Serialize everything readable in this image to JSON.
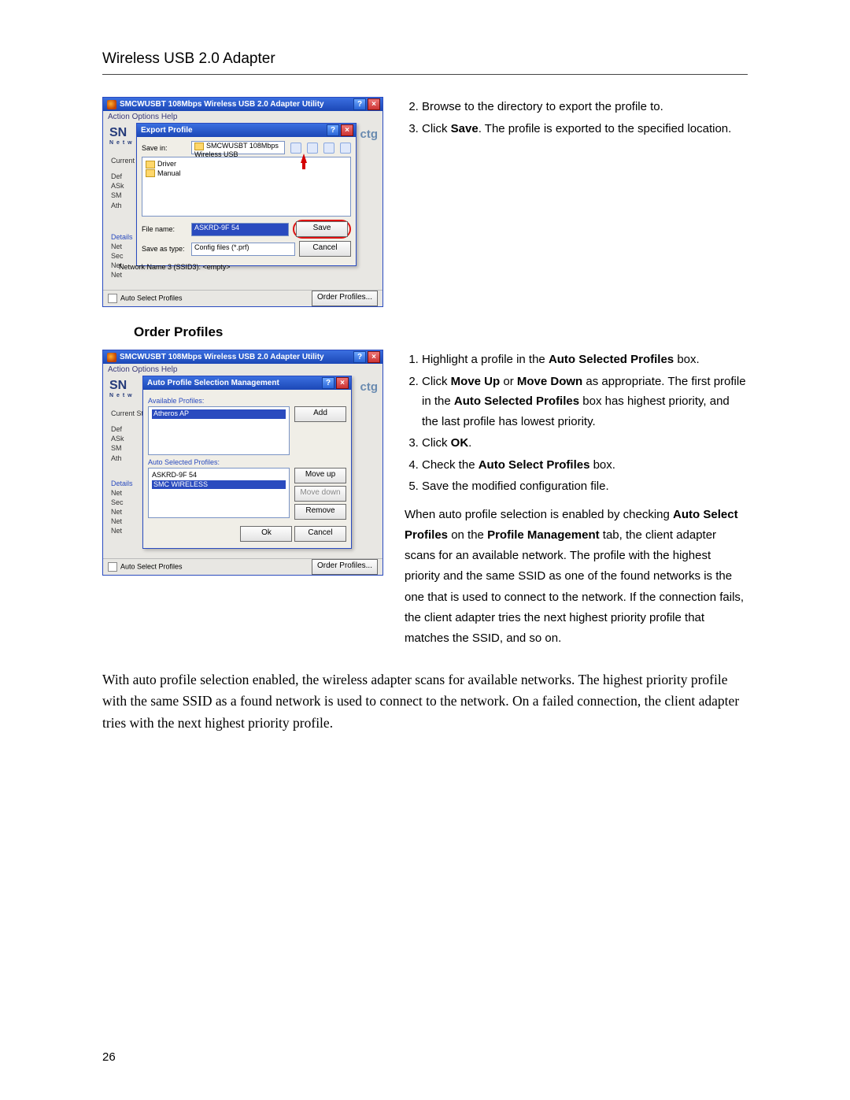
{
  "header": {
    "title": "Wireless USB 2.0 Adapter"
  },
  "steps_export": [
    "Browse to the directory to export the profile to.",
    "Click <b>Save</b>. The profile is exported to the specified location."
  ],
  "section_heading": "Order Profiles",
  "steps_order": [
    "Highlight a profile in the <b>Auto Selected Profiles</b> box.",
    "Click <b>Move Up</b> or <b>Move Down</b> as appropriate. The first profile in the <b>Auto Selected Profiles</b> box has highest priority, and the last profile has lowest priority.",
    "Click <b>OK</b>.",
    "Check the <b>Auto Select Profiles</b> box.",
    "Save the modified configuration file."
  ],
  "para_after_steps": "When auto profile selection is enabled by checking <b>Auto Select Profiles</b> on the <b>Profile Management</b> tab, the client adapter scans for an available network. The profile with the highest priority and the same SSID as one of the found networks is the one that is used to connect to the network. If the connection fails, the client adapter tries the next highest priority profile that matches the SSID, and so on.",
  "summary_para": "With auto profile selection enabled, the wireless adapter scans for available networks. The highest priority profile with the same SSID as a found network is used to connect to the network. On a failed connection, the client adapter tries with the next highest priority profile.",
  "page_number": "26",
  "shot1": {
    "parent_title": "SMCWUSBT 108Mbps Wireless USB 2.0 Adapter Utility",
    "menubar": "Action   Options   Help",
    "logo": "SN",
    "logo_sub": "N e t w",
    "ctg": "ctg",
    "current_sta": "Current Sta",
    "side_rows": [
      "Def",
      "ASk",
      "SM",
      "Ath"
    ],
    "details_hdr": "Details",
    "details_rows": [
      "Net",
      "Sec",
      "Net",
      "Net"
    ],
    "ssid_row": "Network Name 3 (SSID3):   <empty>",
    "autosel_label": "Auto Select Profiles",
    "order_btn": "Order Profiles...",
    "dialog_title": "Export Profile",
    "savein_lbl": "Save in:",
    "savein_val": "SMCWUSBT 108Mbps Wireless USB",
    "folders": [
      "Driver",
      "Manual"
    ],
    "filename_lbl": "File name:",
    "filename_val": "ASKRD-9F 54",
    "savetype_lbl": "Save as type:",
    "savetype_val": "Config files (*.prf)",
    "save_btn": "Save",
    "cancel_btn": "Cancel"
  },
  "shot2": {
    "parent_title": "SMCWUSBT 108Mbps Wireless USB 2.0 Adapter Utility",
    "menubar": "Action   Options   Help",
    "dialog_title": "Auto Profile Selection Management",
    "avail_lbl": "Available Profiles:",
    "avail_items": [
      "Atheros AP"
    ],
    "add_btn": "Add",
    "sel_lbl": "Auto Selected Profiles:",
    "sel_items": [
      "ASKRD-9F 54",
      "SMC WIRELESS"
    ],
    "moveup_btn": "Move up",
    "movedown_btn": "Move down",
    "remove_btn": "Remove",
    "ok_btn": "Ok",
    "cancel_btn": "Cancel",
    "current_sta": "Current Sta",
    "side_rows": [
      "Def",
      "ASk",
      "SM",
      "Ath"
    ],
    "details_hdr": "Details",
    "details_rows": [
      "Net",
      "Sec",
      "Net",
      "Net",
      "Net"
    ],
    "autosel_label": "Auto Select Profiles",
    "order_btn": "Order Profiles...",
    "logo": "SN",
    "logo_sub": "N e t w",
    "ctg": "ctg"
  }
}
